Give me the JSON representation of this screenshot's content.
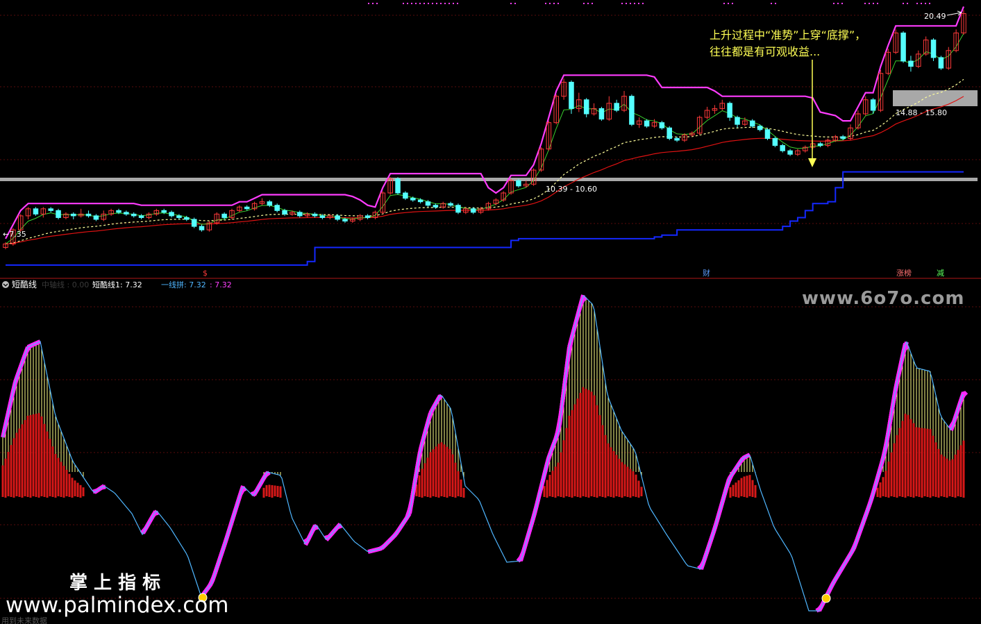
{
  "colors": {
    "background": "#000000",
    "grid": "#5a0d0d",
    "divider": "#b01818",
    "candle_up": "#ff3a3a",
    "candle_down": "#54ffff",
    "channel_upper": "#ff3cff",
    "channel_lower": "#1428ff",
    "fast_line": "#39d12e",
    "ma_dashed": "#ffff9c",
    "ma_solid": "#e01212",
    "zone": "#a8a8a8",
    "annotation": "#ffff55",
    "watermark": "#9a9a9a",
    "osc_line": "#4fb6ff",
    "osc_fill": "#ff28ff",
    "osc_histogram": "#d71818",
    "osc_vertical": "#ffff88"
  },
  "top_panel": {
    "annotation": [
      "上升过程中“准势”上穿“底撑”，",
      "往往都是有可观收益..."
    ],
    "price_marks": [
      {
        "label": "←7.35"
      },
      {
        "label": "20.49"
      }
    ],
    "zones": [
      {
        "label": "10.39 - 10.60",
        "low": 10.39,
        "high": 10.6
      },
      {
        "label": "14.88 - 15.80",
        "low": 14.88,
        "high": 15.8
      }
    ],
    "event_tags": [
      {
        "label": "$",
        "color": "#ff3a3a"
      },
      {
        "label": "财",
        "color": "#5b9bff"
      },
      {
        "label": "涨榜",
        "color": "#ff7070"
      },
      {
        "label": "减",
        "color": "#5cff5c"
      }
    ]
  },
  "bottom_panel": {
    "title": "短酷线",
    "hidden_label": "中轴线 : 0.00",
    "legend": [
      {
        "label": "短酷线1: 7.32",
        "color": "#ffffff"
      },
      {
        "label": "一线拼: 7.32",
        "color": "#4fb6ff"
      },
      {
        "label": ": 7.32",
        "color": "#ff40ff"
      }
    ],
    "footer_text": "用到未来数据"
  },
  "watermarks": {
    "site_top": "www.6o7o.com",
    "brand_cn": "掌 上 指 标",
    "site_bottom": "www.palmindex.com"
  },
  "chart_data": {
    "type": "candlestick",
    "price_range": [
      6,
      21
    ],
    "candles": [
      {
        "o": 7.4,
        "c": 7.6,
        "h": 7.7,
        "l": 7.3
      },
      {
        "o": 7.6,
        "c": 8.4,
        "h": 8.5,
        "l": 7.5
      },
      {
        "o": 8.4,
        "c": 9.2,
        "h": 9.3,
        "l": 8.3
      },
      {
        "o": 9.2,
        "c": 9.6,
        "h": 9.7,
        "l": 9.0
      },
      {
        "o": 9.6,
        "c": 9.3,
        "h": 9.7,
        "l": 9.2
      },
      {
        "o": 9.3,
        "c": 9.6,
        "h": 9.7,
        "l": 9.1
      },
      {
        "o": 9.6,
        "c": 9.5,
        "h": 9.7,
        "l": 9.4
      },
      {
        "o": 9.5,
        "c": 9.1,
        "h": 9.6,
        "l": 9.0
      },
      {
        "o": 9.1,
        "c": 9.3,
        "h": 9.4,
        "l": 9.0
      },
      {
        "o": 9.3,
        "c": 9.2,
        "h": 9.4,
        "l": 9.0
      },
      {
        "o": 9.2,
        "c": 9.3,
        "h": 9.6,
        "l": 9.1
      },
      {
        "o": 9.3,
        "c": 9.2,
        "h": 9.5,
        "l": 9.1
      },
      {
        "o": 9.2,
        "c": 9.0,
        "h": 9.3,
        "l": 8.9
      },
      {
        "o": 9.0,
        "c": 9.3,
        "h": 9.5,
        "l": 8.9
      },
      {
        "o": 9.3,
        "c": 9.5,
        "h": 9.6,
        "l": 9.2
      },
      {
        "o": 9.5,
        "c": 9.4,
        "h": 9.6,
        "l": 9.3
      },
      {
        "o": 9.4,
        "c": 9.3,
        "h": 9.5,
        "l": 9.2
      },
      {
        "o": 9.3,
        "c": 9.2,
        "h": 9.4,
        "l": 9.1
      },
      {
        "o": 9.2,
        "c": 9.1,
        "h": 9.3,
        "l": 9.0
      },
      {
        "o": 9.1,
        "c": 9.3,
        "h": 9.4,
        "l": 9.0
      },
      {
        "o": 9.3,
        "c": 9.5,
        "h": 9.6,
        "l": 9.2
      },
      {
        "o": 9.5,
        "c": 9.4,
        "h": 9.6,
        "l": 9.3
      },
      {
        "o": 9.4,
        "c": 9.2,
        "h": 9.5,
        "l": 9.1
      },
      {
        "o": 9.2,
        "c": 9.1,
        "h": 9.3,
        "l": 9.0
      },
      {
        "o": 9.1,
        "c": 9.0,
        "h": 9.2,
        "l": 8.9
      },
      {
        "o": 9.0,
        "c": 8.6,
        "h": 9.1,
        "l": 8.5
      },
      {
        "o": 8.6,
        "c": 8.4,
        "h": 8.7,
        "l": 8.3
      },
      {
        "o": 8.4,
        "c": 8.8,
        "h": 8.9,
        "l": 8.3
      },
      {
        "o": 8.8,
        "c": 9.3,
        "h": 9.4,
        "l": 8.7
      },
      {
        "o": 9.3,
        "c": 9.1,
        "h": 9.4,
        "l": 9.0
      },
      {
        "o": 9.1,
        "c": 9.5,
        "h": 9.6,
        "l": 9.0
      },
      {
        "o": 9.5,
        "c": 9.7,
        "h": 9.8,
        "l": 9.4
      },
      {
        "o": 9.7,
        "c": 9.6,
        "h": 9.8,
        "l": 9.5
      },
      {
        "o": 9.6,
        "c": 9.9,
        "h": 10.0,
        "l": 9.5
      },
      {
        "o": 9.9,
        "c": 10.0,
        "h": 10.2,
        "l": 9.8
      },
      {
        "o": 10.0,
        "c": 9.8,
        "h": 10.1,
        "l": 9.7
      },
      {
        "o": 9.8,
        "c": 9.5,
        "h": 9.9,
        "l": 9.4
      },
      {
        "o": 9.5,
        "c": 9.3,
        "h": 9.6,
        "l": 9.2
      },
      {
        "o": 9.3,
        "c": 9.4,
        "h": 9.5,
        "l": 9.2
      },
      {
        "o": 9.4,
        "c": 9.2,
        "h": 9.5,
        "l": 9.1
      },
      {
        "o": 9.2,
        "c": 9.3,
        "h": 9.4,
        "l": 9.1
      },
      {
        "o": 9.3,
        "c": 9.2,
        "h": 9.4,
        "l": 9.1
      },
      {
        "o": 9.2,
        "c": 9.1,
        "h": 9.3,
        "l": 9.0
      },
      {
        "o": 9.1,
        "c": 9.2,
        "h": 9.3,
        "l": 9.0
      },
      {
        "o": 9.2,
        "c": 9.0,
        "h": 9.3,
        "l": 8.9
      },
      {
        "o": 9.0,
        "c": 8.9,
        "h": 9.1,
        "l": 8.8
      },
      {
        "o": 8.9,
        "c": 9.0,
        "h": 9.1,
        "l": 8.8
      },
      {
        "o": 9.0,
        "c": 9.2,
        "h": 9.3,
        "l": 8.9
      },
      {
        "o": 9.2,
        "c": 9.1,
        "h": 9.3,
        "l": 9.0
      },
      {
        "o": 9.1,
        "c": 9.4,
        "h": 9.5,
        "l": 9.0
      },
      {
        "o": 9.4,
        "c": 10.5,
        "h": 10.6,
        "l": 9.3
      },
      {
        "o": 10.5,
        "c": 11.3,
        "h": 11.4,
        "l": 10.4
      },
      {
        "o": 11.3,
        "c": 10.5,
        "h": 11.4,
        "l": 10.4
      },
      {
        "o": 10.5,
        "c": 10.2,
        "h": 10.6,
        "l": 10.1
      },
      {
        "o": 10.2,
        "c": 10.1,
        "h": 10.3,
        "l": 10.0
      },
      {
        "o": 10.1,
        "c": 10.0,
        "h": 10.2,
        "l": 9.9
      },
      {
        "o": 10.0,
        "c": 9.8,
        "h": 10.1,
        "l": 9.7
      },
      {
        "o": 9.8,
        "c": 9.7,
        "h": 9.9,
        "l": 9.6
      },
      {
        "o": 9.7,
        "c": 9.9,
        "h": 10.0,
        "l": 9.6
      },
      {
        "o": 9.9,
        "c": 9.8,
        "h": 10.0,
        "l": 9.7
      },
      {
        "o": 9.8,
        "c": 9.4,
        "h": 9.9,
        "l": 9.3
      },
      {
        "o": 9.4,
        "c": 9.6,
        "h": 9.7,
        "l": 9.3
      },
      {
        "o": 9.6,
        "c": 9.4,
        "h": 9.7,
        "l": 9.3
      },
      {
        "o": 9.4,
        "c": 9.6,
        "h": 9.7,
        "l": 9.3
      },
      {
        "o": 9.6,
        "c": 9.9,
        "h": 10.0,
        "l": 9.5
      },
      {
        "o": 9.9,
        "c": 10.1,
        "h": 10.2,
        "l": 9.8
      },
      {
        "o": 10.1,
        "c": 10.5,
        "h": 10.6,
        "l": 10.0
      },
      {
        "o": 10.5,
        "c": 11.2,
        "h": 11.3,
        "l": 10.4
      },
      {
        "o": 11.2,
        "c": 10.9,
        "h": 11.3,
        "l": 10.8
      },
      {
        "o": 10.9,
        "c": 11.0,
        "h": 11.2,
        "l": 10.8
      },
      {
        "o": 11.0,
        "c": 11.8,
        "h": 11.9,
        "l": 10.9
      },
      {
        "o": 11.8,
        "c": 13.0,
        "h": 13.1,
        "l": 11.7
      },
      {
        "o": 13.0,
        "c": 14.5,
        "h": 14.6,
        "l": 12.9
      },
      {
        "o": 14.5,
        "c": 16.0,
        "h": 16.1,
        "l": 14.4
      },
      {
        "o": 16.0,
        "c": 16.8,
        "h": 17.0,
        "l": 15.8
      },
      {
        "o": 16.8,
        "c": 15.3,
        "h": 16.9,
        "l": 15.0
      },
      {
        "o": 15.3,
        "c": 15.8,
        "h": 16.2,
        "l": 15.1
      },
      {
        "o": 15.8,
        "c": 15.0,
        "h": 15.9,
        "l": 14.8
      },
      {
        "o": 15.0,
        "c": 15.3,
        "h": 15.6,
        "l": 14.9
      },
      {
        "o": 15.3,
        "c": 14.7,
        "h": 15.4,
        "l": 14.6
      },
      {
        "o": 14.7,
        "c": 15.6,
        "h": 16.0,
        "l": 14.6
      },
      {
        "o": 15.6,
        "c": 15.2,
        "h": 15.8,
        "l": 15.1
      },
      {
        "o": 15.2,
        "c": 16.0,
        "h": 16.3,
        "l": 15.1
      },
      {
        "o": 16.0,
        "c": 14.4,
        "h": 16.1,
        "l": 14.3
      },
      {
        "o": 14.4,
        "c": 14.6,
        "h": 14.8,
        "l": 14.2
      },
      {
        "o": 14.6,
        "c": 14.3,
        "h": 14.7,
        "l": 14.2
      },
      {
        "o": 14.3,
        "c": 14.5,
        "h": 14.7,
        "l": 14.2
      },
      {
        "o": 14.5,
        "c": 14.2,
        "h": 14.6,
        "l": 14.1
      },
      {
        "o": 14.2,
        "c": 13.6,
        "h": 14.3,
        "l": 13.5
      },
      {
        "o": 13.6,
        "c": 13.5,
        "h": 13.7,
        "l": 13.4
      },
      {
        "o": 13.5,
        "c": 13.8,
        "h": 13.9,
        "l": 13.4
      },
      {
        "o": 13.8,
        "c": 13.9,
        "h": 14.0,
        "l": 13.7
      },
      {
        "o": 13.9,
        "c": 14.8,
        "h": 14.9,
        "l": 13.8
      },
      {
        "o": 14.8,
        "c": 15.2,
        "h": 15.4,
        "l": 14.7
      },
      {
        "o": 15.2,
        "c": 15.3,
        "h": 15.5,
        "l": 15.0
      },
      {
        "o": 15.3,
        "c": 15.6,
        "h": 15.8,
        "l": 15.2
      },
      {
        "o": 15.6,
        "c": 14.8,
        "h": 15.7,
        "l": 14.6
      },
      {
        "o": 14.8,
        "c": 14.4,
        "h": 14.9,
        "l": 14.2
      },
      {
        "o": 14.4,
        "c": 14.6,
        "h": 14.8,
        "l": 14.3
      },
      {
        "o": 14.6,
        "c": 14.3,
        "h": 14.7,
        "l": 14.2
      },
      {
        "o": 14.3,
        "c": 14.1,
        "h": 14.4,
        "l": 14.0
      },
      {
        "o": 14.1,
        "c": 13.6,
        "h": 14.2,
        "l": 13.5
      },
      {
        "o": 13.6,
        "c": 13.2,
        "h": 13.7,
        "l": 13.1
      },
      {
        "o": 13.2,
        "c": 12.9,
        "h": 13.3,
        "l": 12.8
      },
      {
        "o": 12.9,
        "c": 12.7,
        "h": 13.0,
        "l": 12.6
      },
      {
        "o": 12.7,
        "c": 12.9,
        "h": 13.0,
        "l": 12.6
      },
      {
        "o": 12.9,
        "c": 13.1,
        "h": 13.2,
        "l": 12.8
      },
      {
        "o": 13.1,
        "c": 13.3,
        "h": 13.4,
        "l": 13.0
      },
      {
        "o": 13.3,
        "c": 13.2,
        "h": 13.4,
        "l": 13.1
      },
      {
        "o": 13.2,
        "c": 13.5,
        "h": 13.6,
        "l": 13.1
      },
      {
        "o": 13.5,
        "c": 13.7,
        "h": 13.8,
        "l": 13.4
      },
      {
        "o": 13.7,
        "c": 13.6,
        "h": 13.8,
        "l": 13.5
      },
      {
        "o": 13.6,
        "c": 14.2,
        "h": 14.4,
        "l": 13.5
      },
      {
        "o": 14.2,
        "c": 15.0,
        "h": 15.2,
        "l": 14.1
      },
      {
        "o": 15.0,
        "c": 15.8,
        "h": 16.0,
        "l": 14.9
      },
      {
        "o": 15.8,
        "c": 15.2,
        "h": 15.9,
        "l": 15.0
      },
      {
        "o": 15.2,
        "c": 17.3,
        "h": 17.5,
        "l": 15.1
      },
      {
        "o": 17.3,
        "c": 18.5,
        "h": 18.7,
        "l": 17.2
      },
      {
        "o": 18.5,
        "c": 19.6,
        "h": 19.8,
        "l": 18.4
      },
      {
        "o": 19.6,
        "c": 18.0,
        "h": 19.7,
        "l": 17.9
      },
      {
        "o": 18.0,
        "c": 17.7,
        "h": 18.3,
        "l": 17.4
      },
      {
        "o": 17.7,
        "c": 18.4,
        "h": 18.6,
        "l": 17.6
      },
      {
        "o": 18.4,
        "c": 19.2,
        "h": 19.4,
        "l": 18.3
      },
      {
        "o": 19.2,
        "c": 18.2,
        "h": 19.3,
        "l": 18.0
      },
      {
        "o": 18.2,
        "c": 17.6,
        "h": 18.3,
        "l": 17.5
      },
      {
        "o": 17.6,
        "c": 18.6,
        "h": 18.8,
        "l": 17.5
      },
      {
        "o": 18.6,
        "c": 19.6,
        "h": 19.8,
        "l": 18.5
      },
      {
        "o": 19.6,
        "c": 20.7,
        "h": 20.9,
        "l": 19.5
      }
    ],
    "oscillator_valleys": [
      {
        "label": "bottom-signal-1"
      },
      {
        "label": "bottom-signal-2"
      }
    ]
  }
}
